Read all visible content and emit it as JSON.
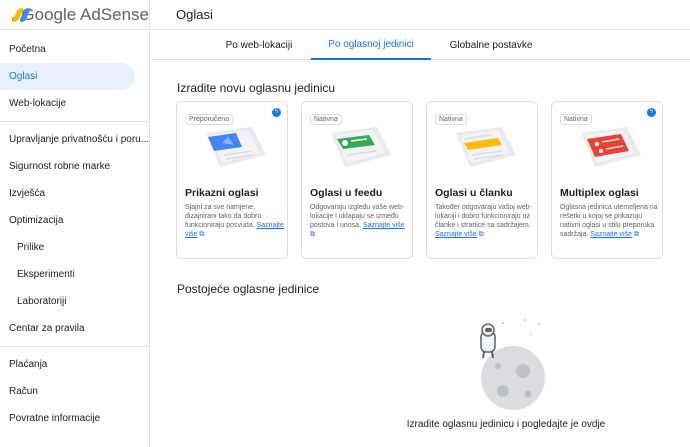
{
  "app": {
    "logo_text": "Google AdSense"
  },
  "header": {
    "title": "Oglasi"
  },
  "sidebar": {
    "items": [
      {
        "label": "Početna"
      },
      {
        "label": "Oglasi"
      },
      {
        "label": "Web-lokacije"
      },
      {
        "label": "Upravljanje privatnošću i poru..."
      },
      {
        "label": "Sigurnost robne marke"
      },
      {
        "label": "Izvješća"
      },
      {
        "label": "Optimizacija"
      },
      {
        "label": "Prilike"
      },
      {
        "label": "Eksperimenti"
      },
      {
        "label": "Laboratoriji"
      },
      {
        "label": "Centar za pravila"
      },
      {
        "label": "Plaćanja"
      },
      {
        "label": "Račun"
      },
      {
        "label": "Povratne informacije"
      }
    ]
  },
  "tabs": [
    {
      "label": "Po web-lokaciji"
    },
    {
      "label": "Po oglasnoj jedinici"
    },
    {
      "label": "Globalne postavke"
    }
  ],
  "create_section": {
    "title": "Izradite novu oglasnu jedinicu"
  },
  "cards": [
    {
      "tag": "Preporučeno",
      "title": "Prikazni oglasi",
      "desc": "Sjajni za sve namjene, dizajnirani tako da dobro funkcioniraju posvuda.",
      "link": "Saznajte više",
      "accent": "#4285f4",
      "icon": "display-ad-illustration"
    },
    {
      "tag": "Nativna",
      "title": "Oglasi u feedu",
      "desc": "Odgovaraju izgledu vaše web-lokacije i uklapaju se između postova i unosa.",
      "link": "Saznajte više",
      "accent": "#34a853",
      "icon": "in-feed-ad-illustration"
    },
    {
      "tag": "Nativna",
      "title": "Oglasi u članku",
      "desc": "Također odgovaraju vašoj web-lokaciji i dobro funkcioniraju uz članke i stranice sa sadržajem.",
      "link": "Saznajte više",
      "accent": "#fbbc04",
      "icon": "in-article-ad-illustration"
    },
    {
      "tag": "Nativna",
      "title": "Multiplex oglasi",
      "desc": "Oglasna jedinica utemeljena na rešetki u kojoj se prikazuju nativni oglasi u stilu preporuka sadržaja.",
      "link": "Saznajte više",
      "accent": "#ea4335",
      "icon": "multiplex-ad-illustration"
    }
  ],
  "existing_section": {
    "title": "Postojeće oglasne jedinice",
    "empty_text": "Izradite oglasnu jedinicu i pogledajte je ovdje"
  }
}
